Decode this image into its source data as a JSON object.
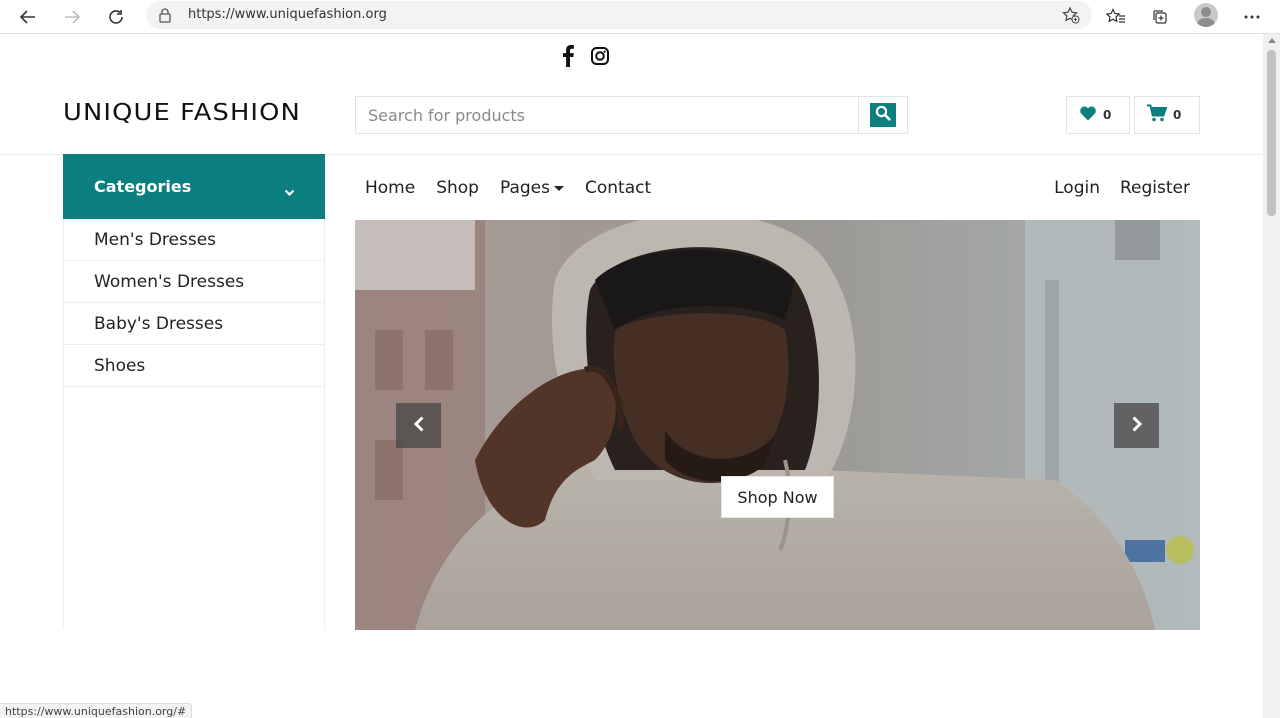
{
  "browser": {
    "url": "https://www.uniquefashion.org",
    "icons": [
      "back-icon",
      "forward-icon",
      "refresh-icon",
      "lock-icon",
      "add-favorite-icon",
      "favorites-icon",
      "collections-icon",
      "profile-avatar",
      "more-icon"
    ]
  },
  "social": {
    "icons": [
      "facebook-icon",
      "instagram-icon"
    ]
  },
  "header": {
    "logo": "UNIQUE FASHION",
    "search_placeholder": "Search for products",
    "wishlist_count": "0",
    "cart_count": "0"
  },
  "categories": {
    "title": "Categories",
    "items": [
      {
        "label": "Men's Dresses"
      },
      {
        "label": "Women's Dresses"
      },
      {
        "label": "Baby's Dresses"
      },
      {
        "label": "Shoes"
      }
    ]
  },
  "nav": {
    "links": [
      {
        "label": "Home"
      },
      {
        "label": "Shop"
      },
      {
        "label": "Pages"
      },
      {
        "label": "Contact"
      }
    ],
    "login": "Login",
    "register": "Register"
  },
  "carousel": {
    "cta": "Shop Now"
  },
  "status_bar": {
    "text": "https://www.uniquefashion.org/#"
  },
  "colors": {
    "accent": "#0b7f7f"
  }
}
